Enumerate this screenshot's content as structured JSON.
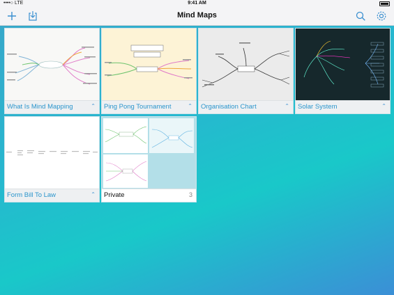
{
  "status_bar": {
    "carrier": "••••○ LTE",
    "time": "9:41 AM"
  },
  "nav": {
    "title": "Mind Maps"
  },
  "maps": [
    {
      "title": "What Is Mind Mapping"
    },
    {
      "title": "Ping Pong Tournament"
    },
    {
      "title": "Organisation Chart"
    },
    {
      "title": "Solar System"
    },
    {
      "title": "Form Bill To Law"
    }
  ],
  "folder": {
    "title": "Private",
    "count": "3"
  },
  "colors": {
    "accent": "#3a8fd0",
    "label": "#2b95cc"
  },
  "icons": [
    "add-icon",
    "import-icon",
    "search-icon",
    "settings-gear-icon",
    "chevron-up-icon",
    "battery-icon"
  ]
}
